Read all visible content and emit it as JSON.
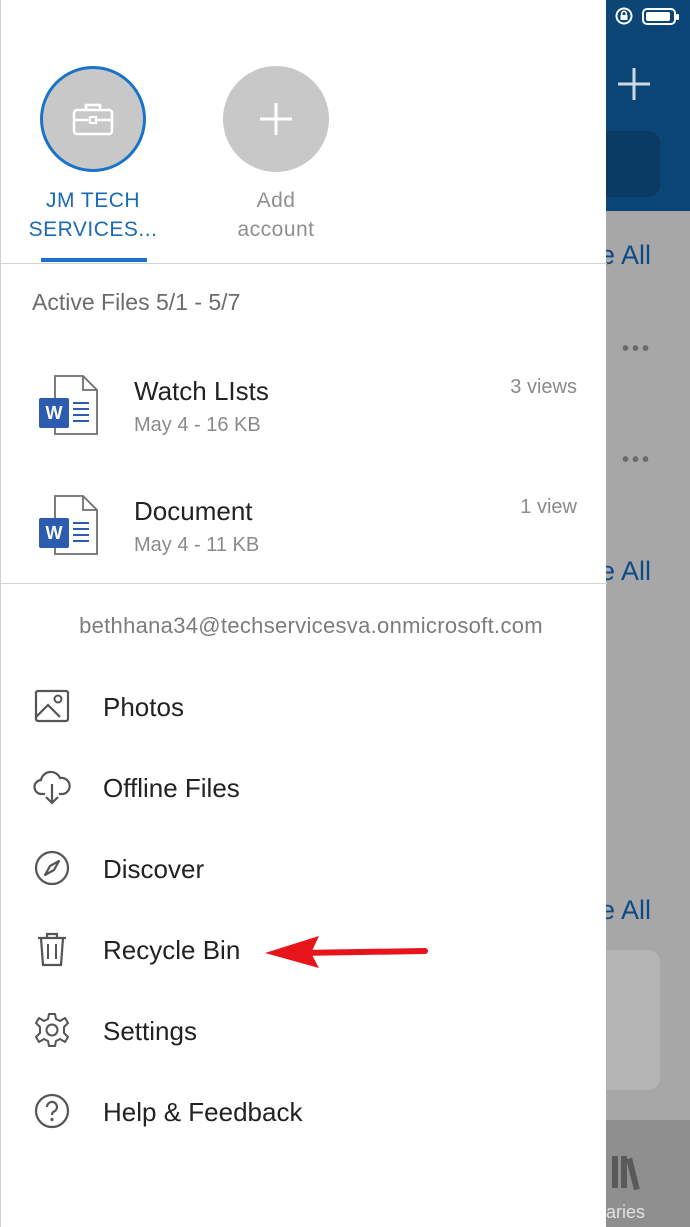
{
  "background_app": {
    "see_all_label": "e All",
    "more_label": "•••",
    "tab_label": "raries"
  },
  "accounts": [
    {
      "label_line1": "JM TECH",
      "label_line2": "SERVICES...",
      "icon": "briefcase-icon",
      "selected": true
    },
    {
      "label_line1": "Add",
      "label_line2": "account",
      "icon": "plus-icon",
      "selected": false
    }
  ],
  "active_files": {
    "header": "Active Files 5/1 - 5/7",
    "items": [
      {
        "name": "Watch LIsts",
        "meta": "May 4 - 16 KB",
        "views": "3 views",
        "icon": "word-doc-icon"
      },
      {
        "name": "Document",
        "meta": "May 4 - 11 KB",
        "views": "1 view",
        "icon": "word-doc-icon"
      }
    ]
  },
  "email": "bethhana34@techservicesva.onmicrosoft.com",
  "menu": [
    {
      "label": "Photos",
      "icon": "photo-icon"
    },
    {
      "label": "Offline Files",
      "icon": "cloud-download-icon"
    },
    {
      "label": "Discover",
      "icon": "compass-icon"
    },
    {
      "label": "Recycle Bin",
      "icon": "trash-icon"
    },
    {
      "label": "Settings",
      "icon": "gear-icon"
    },
    {
      "label": "Help & Feedback",
      "icon": "help-icon"
    }
  ],
  "colors": {
    "accent": "#1a73c8",
    "annotation_arrow": "#e8141c",
    "word_blue": "#2b5cb0"
  }
}
